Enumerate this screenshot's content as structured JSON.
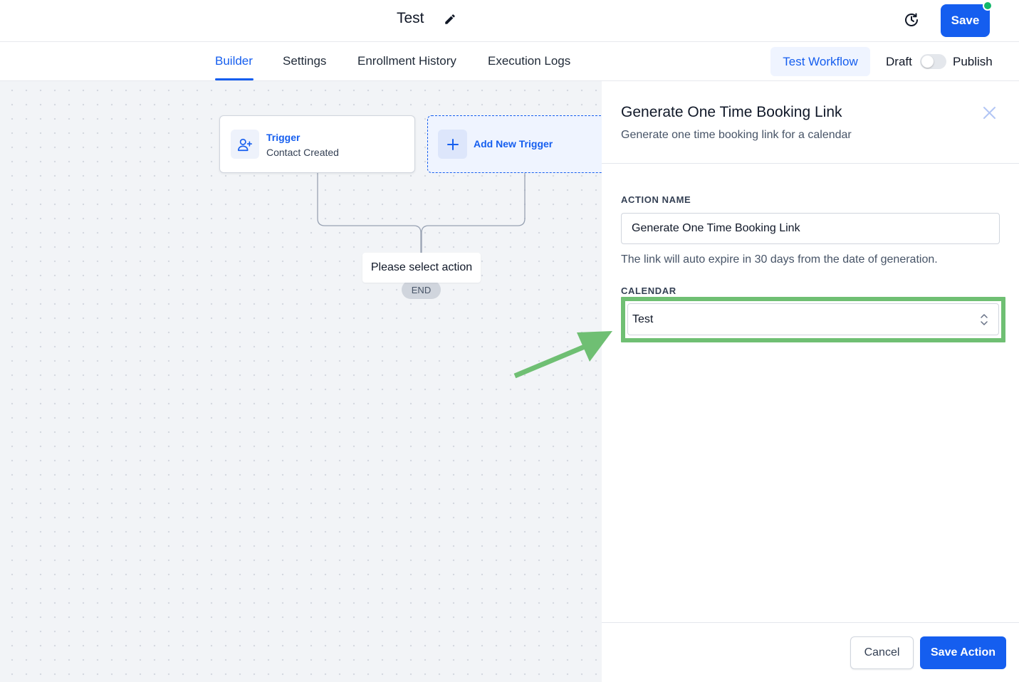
{
  "header": {
    "workflow_title": "Test",
    "save_label": "Save"
  },
  "tabs": {
    "items": [
      {
        "label": "Builder"
      },
      {
        "label": "Settings"
      },
      {
        "label": "Enrollment History"
      },
      {
        "label": "Execution Logs"
      }
    ],
    "active": "Builder",
    "test_workflow_label": "Test Workflow",
    "draft_label": "Draft",
    "publish_label": "Publish",
    "published": false
  },
  "canvas": {
    "trigger": {
      "title": "Trigger",
      "subtitle": "Contact Created"
    },
    "add_trigger_label": "Add New Trigger",
    "select_action_label": "Please select action",
    "end_label": "END"
  },
  "panel": {
    "title": "Generate One Time Booking Link",
    "subtitle": "Generate one time booking link for a calendar",
    "action_name_label": "ACTION NAME",
    "action_name_value": "Generate One Time Booking Link",
    "helper_text": "The link will auto expire in 30 days from the date of generation.",
    "calendar_label": "CALENDAR",
    "calendar_value": "Test",
    "cancel_label": "Cancel",
    "save_action_label": "Save Action"
  },
  "colors": {
    "accent": "#155eef",
    "status_dot": "#12b76a",
    "highlight": "#6fbf73"
  },
  "icons": [
    "edit-icon",
    "history-icon",
    "user-plus-icon",
    "plus-icon",
    "close-icon",
    "chevron-updown-icon",
    "annotation-arrow-icon"
  ]
}
